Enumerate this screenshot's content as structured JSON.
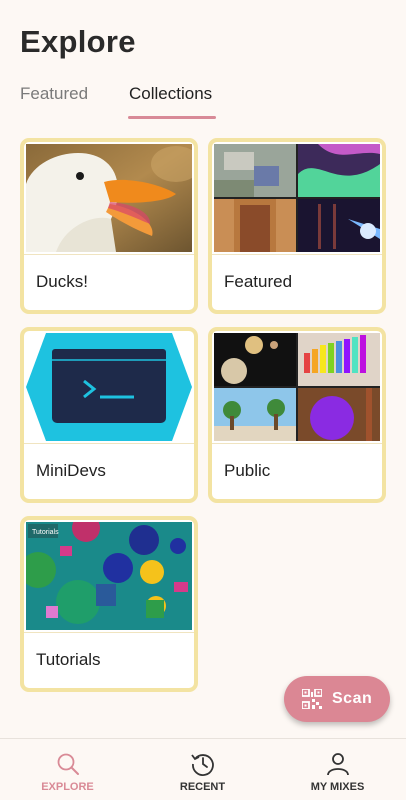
{
  "header": {
    "title": "Explore"
  },
  "tabs": [
    {
      "label": "Featured",
      "active": false
    },
    {
      "label": "Collections",
      "active": true
    }
  ],
  "collections": [
    {
      "label": "Ducks!"
    },
    {
      "label": "Featured"
    },
    {
      "label": "MiniDevs"
    },
    {
      "label": "Public"
    },
    {
      "label": "Tutorials",
      "thumb_caption": "Tutorials"
    }
  ],
  "fab": {
    "label": "Scan",
    "icon": "qr-code-icon"
  },
  "bottom_nav": [
    {
      "label": "EXPLORE",
      "icon": "search-icon",
      "active": true
    },
    {
      "label": "RECENT",
      "icon": "history-icon",
      "active": false
    },
    {
      "label": "MY MIXES",
      "icon": "person-icon",
      "active": false
    }
  ],
  "colors": {
    "accent": "#d88a97",
    "card_border": "#f3e3a2",
    "background": "#fdf8f4"
  }
}
